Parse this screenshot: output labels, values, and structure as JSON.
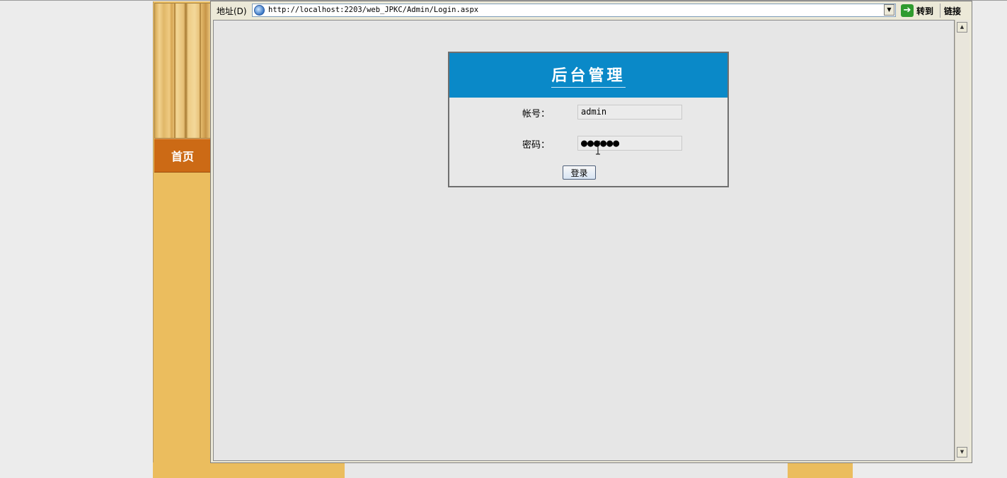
{
  "sidebar": {
    "home_label": "首页"
  },
  "browser": {
    "address_label": "地址(D)",
    "url": "http://localhost:2203/web_JPKC/Admin/Login.aspx",
    "go_label": "转到",
    "links_label": "链接"
  },
  "login": {
    "title": "后台管理",
    "account_label": "帐号：",
    "account_value": "admin",
    "password_label": "密码：",
    "password_masked": "●●●●●●",
    "submit_label": "登录"
  },
  "colors": {
    "header_blue": "#0a89c8",
    "nav_orange": "#cc6a15",
    "side_yellow": "#ebbd5e"
  }
}
